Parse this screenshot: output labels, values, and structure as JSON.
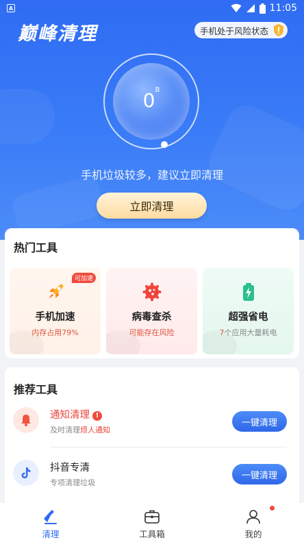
{
  "status_bar": {
    "left_badge": "A",
    "time": "11:05"
  },
  "header": {
    "app_name": "巅峰清理",
    "risk_status": "手机处于风险状态"
  },
  "gauge": {
    "value": "0",
    "unit": "B"
  },
  "hint": "手机垃圾较多，建议立即清理",
  "clean_button": "立即清理",
  "hot_tools": {
    "title": "热门工具",
    "items": [
      {
        "name": "手机加速",
        "sub": "内存占用79%",
        "badge": "可加速",
        "icon": "rocket-icon"
      },
      {
        "name": "病毒查杀",
        "sub": "可能存在风险",
        "icon": "virus-icon"
      },
      {
        "name": "超强省电",
        "sub_count": "7",
        "sub_text": "个应用大量耗电",
        "icon": "battery-icon"
      }
    ]
  },
  "recommended": {
    "title": "推荐工具",
    "items": [
      {
        "name": "通知清理",
        "warn": "!",
        "sub_prefix": "及时清理",
        "sub_highlight": "烦人通知",
        "action": "一键清理",
        "icon": "bell-icon"
      },
      {
        "name": "抖音专清",
        "sub": "专项清理垃圾",
        "action": "一键清理",
        "icon": "tiktok-icon"
      }
    ]
  },
  "nav": {
    "items": [
      "清理",
      "工具箱",
      "我的"
    ]
  },
  "colors": {
    "primary": "#2f6cf3",
    "accent_red": "#f04a3c",
    "gold_button": "#ffdca1"
  }
}
